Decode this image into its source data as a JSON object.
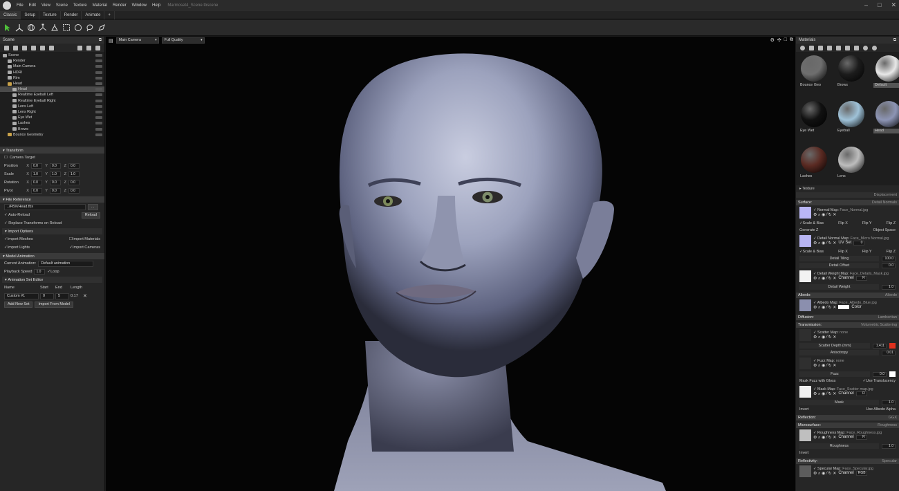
{
  "menubar": {
    "items": [
      "File",
      "Edit",
      "View",
      "Scene",
      "Texture",
      "Material",
      "Render",
      "Window",
      "Help"
    ],
    "document": "Marmoset4_Scene.tbscene"
  },
  "tabs": [
    "Classic",
    "Setup",
    "Texture",
    "Render",
    "Animate",
    "+"
  ],
  "scene_panel": {
    "title": "Scene",
    "tree": [
      {
        "label": "Scene",
        "indent": 0,
        "selected": false
      },
      {
        "label": "Render",
        "indent": 1,
        "selected": false
      },
      {
        "label": "Main Camera",
        "indent": 1,
        "selected": false
      },
      {
        "label": "HDRI",
        "indent": 1,
        "selected": false
      },
      {
        "label": "Rim",
        "indent": 1,
        "selected": false
      },
      {
        "label": "Head",
        "indent": 1,
        "selected": false
      },
      {
        "label": "Head",
        "indent": 2,
        "selected": true
      },
      {
        "label": "Realtime Eyeball Left",
        "indent": 2,
        "selected": false
      },
      {
        "label": "Realtime Eyeball Right",
        "indent": 2,
        "selected": false
      },
      {
        "label": "Lens Left",
        "indent": 2,
        "selected": false
      },
      {
        "label": "Lens Right",
        "indent": 2,
        "selected": false
      },
      {
        "label": "Eye Wet",
        "indent": 2,
        "selected": false
      },
      {
        "label": "Lashes",
        "indent": 2,
        "selected": false
      },
      {
        "label": "Brows",
        "indent": 2,
        "selected": false
      },
      {
        "label": "Bounce Geometry",
        "indent": 1,
        "selected": false
      }
    ]
  },
  "transform": {
    "title": "Transform",
    "camera_target": "Camera Target",
    "rows": [
      {
        "label": "Position",
        "x": "0.0",
        "y": "0.0",
        "z": "0.0"
      },
      {
        "label": "Scale",
        "x": "1.0",
        "y": "1.0",
        "z": "1.0"
      },
      {
        "label": "Rotation",
        "x": "0.0",
        "y": "0.0",
        "z": "0.0"
      },
      {
        "label": "Pivot",
        "x": "0.0",
        "y": "0.0",
        "z": "0.0"
      }
    ]
  },
  "file_reference": {
    "title": "File Reference",
    "path": "../FBX/Head.fbx",
    "browse": "...",
    "auto_reload": "Auto-Reload",
    "reload": "Reload",
    "replace": "Replace Transforms on Reload",
    "import_options": "Import Options",
    "import_meshes": "Import Meshes",
    "import_materials": "Import Materials",
    "import_lights": "Import Lights",
    "import_cameras": "Import Cameras"
  },
  "model_animation": {
    "title": "Model Animation",
    "current_label": "Current Animation:",
    "current_value": "Default animation",
    "speed_label": "Playback Speed",
    "speed_value": "1.0",
    "loop": "Loop",
    "set_editor": "Animation Set Editor",
    "cols": [
      "Name",
      "Start",
      "End",
      "Length"
    ],
    "row": {
      "name": "Custom #1",
      "start": "0",
      "end": "5",
      "length": "0.17"
    },
    "add_new": "Add New Set",
    "import_model": "Import From Model"
  },
  "viewport": {
    "camera": "Main Camera",
    "quality": "Full Quality"
  },
  "materials": {
    "title": "Materials",
    "items": [
      {
        "label": "Bounce Geo",
        "color": "#6e6e6e",
        "selected": false
      },
      {
        "label": "Brows",
        "color": "#1c1c1c",
        "selected": false
      },
      {
        "label": "Default",
        "color": "#e8e8e8",
        "selected": true
      },
      {
        "label": "Eye Wet",
        "color": "#111111",
        "selected": false
      },
      {
        "label": "Eyeball",
        "color": "#9fc2d8",
        "selected": false
      },
      {
        "label": "Head",
        "color": "#8d95b5",
        "selected": true
      },
      {
        "label": "Lashes",
        "color": "#5a2a22",
        "selected": false
      },
      {
        "label": "Lens",
        "color": "#bdbdbd",
        "selected": false
      }
    ]
  },
  "texture_label": "Texture",
  "displacement": "Displacement",
  "surface": {
    "title": "Surface:",
    "mode": "Detail Normals",
    "normal_map": "Normal Map:",
    "normal_file": "Face_Normal.jpg",
    "scale_bias": "Scale & Bias",
    "flip_x": "Flip X",
    "flip_y": "Flip Y",
    "flip_z": "Flip Z",
    "generate_z": "Generate Z",
    "object_space": "Object Space",
    "detail_map": "Detail Normal Map:",
    "detail_file": "Face_Micro Normal.jpg",
    "uv_set": "UV Set",
    "uv_val": "0",
    "detail_tiling": "Detail Tiling",
    "detail_tiling_val": "100.0",
    "detail_offset": "Detail Offset",
    "detail_offset_val": "0.0",
    "weight_map": "Detail Weight Map:",
    "weight_file": "Face_Details_Mask.jpg",
    "channel": "Channel",
    "channel_val": "R",
    "detail_weight": "Detail Weight",
    "detail_weight_val": "1.0"
  },
  "albedo": {
    "title": "Albedo:",
    "mode": "Albedo",
    "map": "Albedo Map:",
    "file": "Face_Albedo_Blue.jpg",
    "color": "Color"
  },
  "diffusion": {
    "title": "Diffusion:",
    "mode": "Lambertian"
  },
  "transmission": {
    "title": "Transmission:",
    "mode": "Volumetric Scattering",
    "scatter_map": "Scatter Map:",
    "scatter_file": "none",
    "scatter_depth": "Scatter Depth (mm)",
    "scatter_depth_val": "1.411",
    "anisotropy": "Anisotropy",
    "anisotropy_val": "0.01",
    "fuzz_map": "Fuzz Map:",
    "fuzz_file": "none",
    "fuzz": "Fuzz",
    "fuzz_val": "0.0",
    "mask_fuzz": "Mask Fuzz with Gloss",
    "use_translucency": "Use Translucency",
    "mask_map": "Mask Map:",
    "mask_file": "Face_Scatter map.jpg",
    "mask": "Mask",
    "mask_val": "1.0",
    "invert": "Invert",
    "use_albedo_alpha": "Use Albedo Alpha"
  },
  "reflection": {
    "title": "Reflection:",
    "mode": "GGX"
  },
  "microsurface": {
    "title": "Microsurface:",
    "mode": "Roughness",
    "map": "Roughness Map:",
    "file": "Face_Roughness.jpg",
    "roughness": "Roughness",
    "roughness_val": "1.0",
    "invert": "Invert"
  },
  "reflectivity": {
    "title": "Reflectivity:",
    "mode": "Specular",
    "map": "Specular Map:",
    "file": "Face_Specular.jpg",
    "channel_val": "RGB"
  },
  "colors": {
    "accent_green": "#4fc03a",
    "scatter_red": "#e0301e",
    "selected": "#4a4a4a"
  }
}
